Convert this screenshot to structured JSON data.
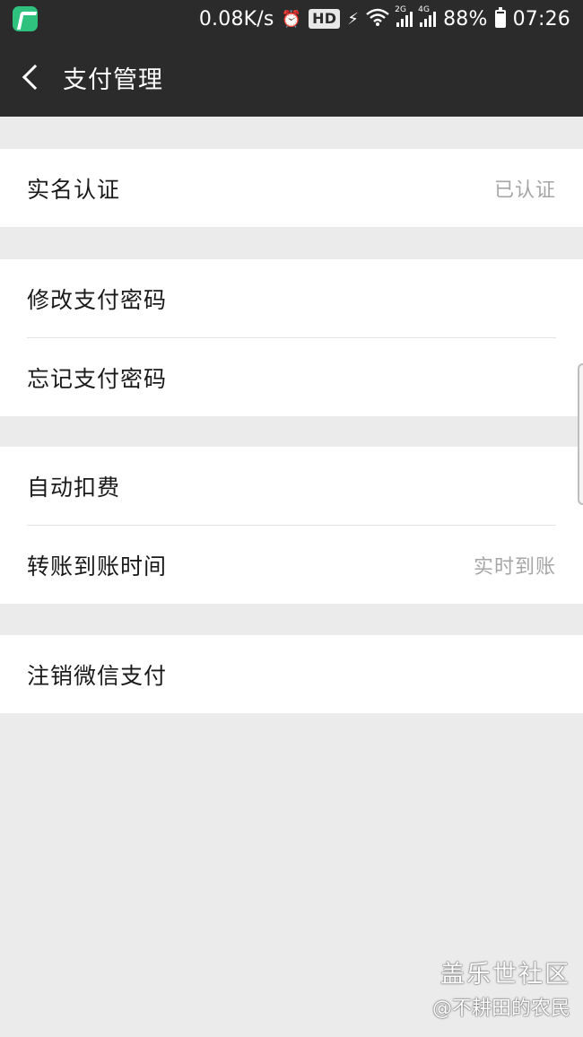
{
  "status_bar": {
    "net_speed": "0.08K/s",
    "hd_badge": "HD",
    "sig1_tag": "2G",
    "sig2_tag": "4G",
    "battery": "88%",
    "time": "07:26",
    "battery_level_percent": 88
  },
  "header": {
    "title": "支付管理"
  },
  "sections": {
    "identity": {
      "label": "实名认证",
      "value": "已认证"
    },
    "change_password": {
      "label": "修改支付密码"
    },
    "forgot_password": {
      "label": "忘记支付密码"
    },
    "auto_deduct": {
      "label": "自动扣费"
    },
    "transfer_time": {
      "label": "转账到账时间",
      "value": "实时到账"
    },
    "cancel_pay": {
      "label": "注销微信支付"
    }
  },
  "watermark": {
    "line1": "盖乐世社区",
    "line2": "@不耕田的农民"
  },
  "colors": {
    "bar_background": "#2b2b2b",
    "page_background": "#ebebeb",
    "row_background": "#ffffff",
    "secondary_text": "#a6a6a6"
  }
}
